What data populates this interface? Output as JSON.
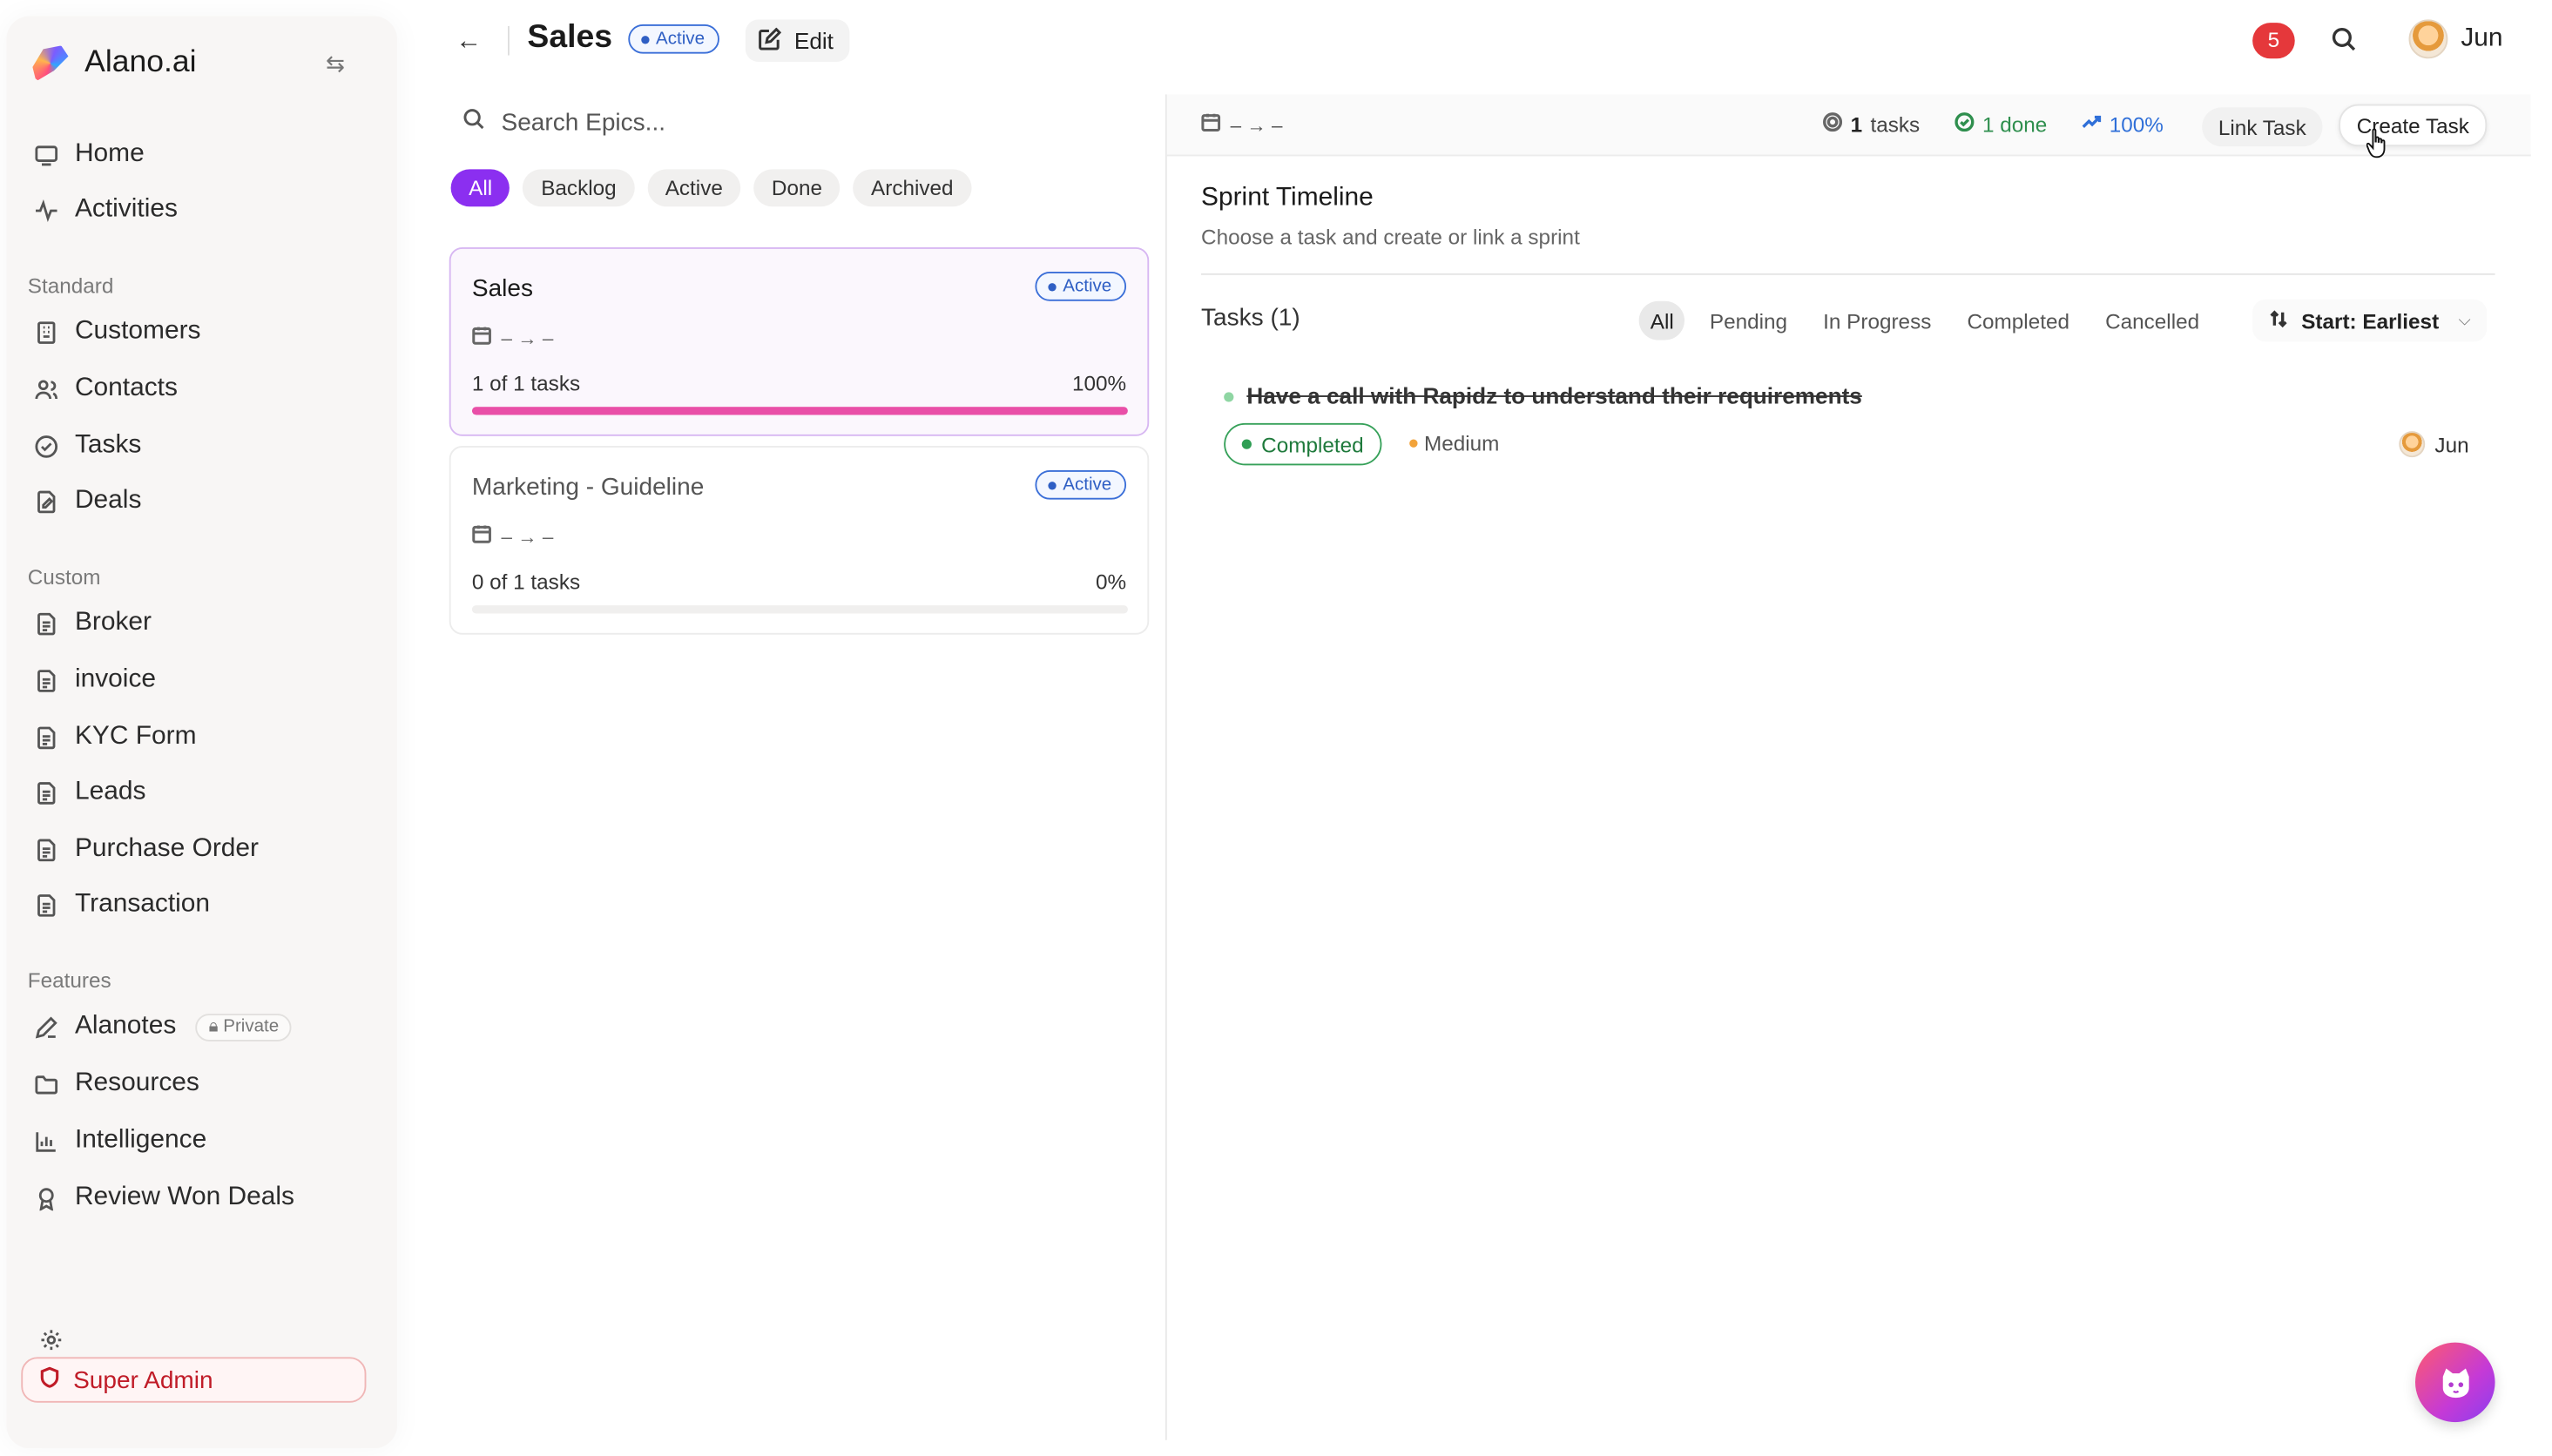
{
  "app": {
    "name": "Alano.ai"
  },
  "sidebar": {
    "main": [
      {
        "label": "Home",
        "icon": "monitor-icon"
      },
      {
        "label": "Activities",
        "icon": "activity-icon"
      }
    ],
    "sections": [
      {
        "title": "Standard",
        "items": [
          "Customers",
          "Contacts",
          "Tasks",
          "Deals"
        ]
      },
      {
        "title": "Custom",
        "items": [
          "Broker",
          "invoice",
          "KYC Form",
          "Leads",
          "Purchase Order",
          "Transaction"
        ]
      },
      {
        "title": "Features",
        "items": [
          "Alanotes",
          "Resources",
          "Intelligence",
          "Review Won Deals"
        ]
      }
    ],
    "private_label": "Private",
    "super_admin": "Super Admin"
  },
  "header": {
    "title": "Sales",
    "status": "Active",
    "edit_label": "Edit",
    "notifications": "5",
    "user": "Jun"
  },
  "epics": {
    "search_placeholder": "Search Epics...",
    "filters": [
      "All",
      "Backlog",
      "Active",
      "Done",
      "Archived"
    ],
    "active_filter": "All",
    "items": [
      {
        "title": "Sales",
        "status": "Active",
        "dates": "– → –",
        "progress_label": "1 of 1 tasks",
        "progress_pct": "100%",
        "progress": 1.0
      },
      {
        "title": "Marketing - Guideline",
        "status": "Active",
        "dates": "– → –",
        "progress_label": "0 of 1 tasks",
        "progress_pct": "0%",
        "progress": 0.0
      }
    ]
  },
  "detail": {
    "dates": "– → –",
    "tasks_count": "1",
    "tasks_word": "tasks",
    "done": "1 done",
    "percent": "100%",
    "link_task": "Link Task",
    "create_task": "Create Task",
    "sprint_title": "Sprint Timeline",
    "sprint_subtitle": "Choose a task and create or link a sprint",
    "tasks_heading": "Tasks (1)",
    "task_tabs": [
      "All",
      "Pending",
      "In Progress",
      "Completed",
      "Cancelled"
    ],
    "active_tab": "All",
    "sort_label": "Start: Earliest",
    "tasks": [
      {
        "title": "Have a call with Rapidz to understand their requirements",
        "status": "Completed",
        "priority": "Medium",
        "assignee": "Jun"
      }
    ]
  },
  "colors": {
    "accent": "#8b2ff0",
    "progress": "#e94fa8",
    "success": "#2f9e54",
    "danger": "#e5383b",
    "info": "#2f6fd8"
  }
}
